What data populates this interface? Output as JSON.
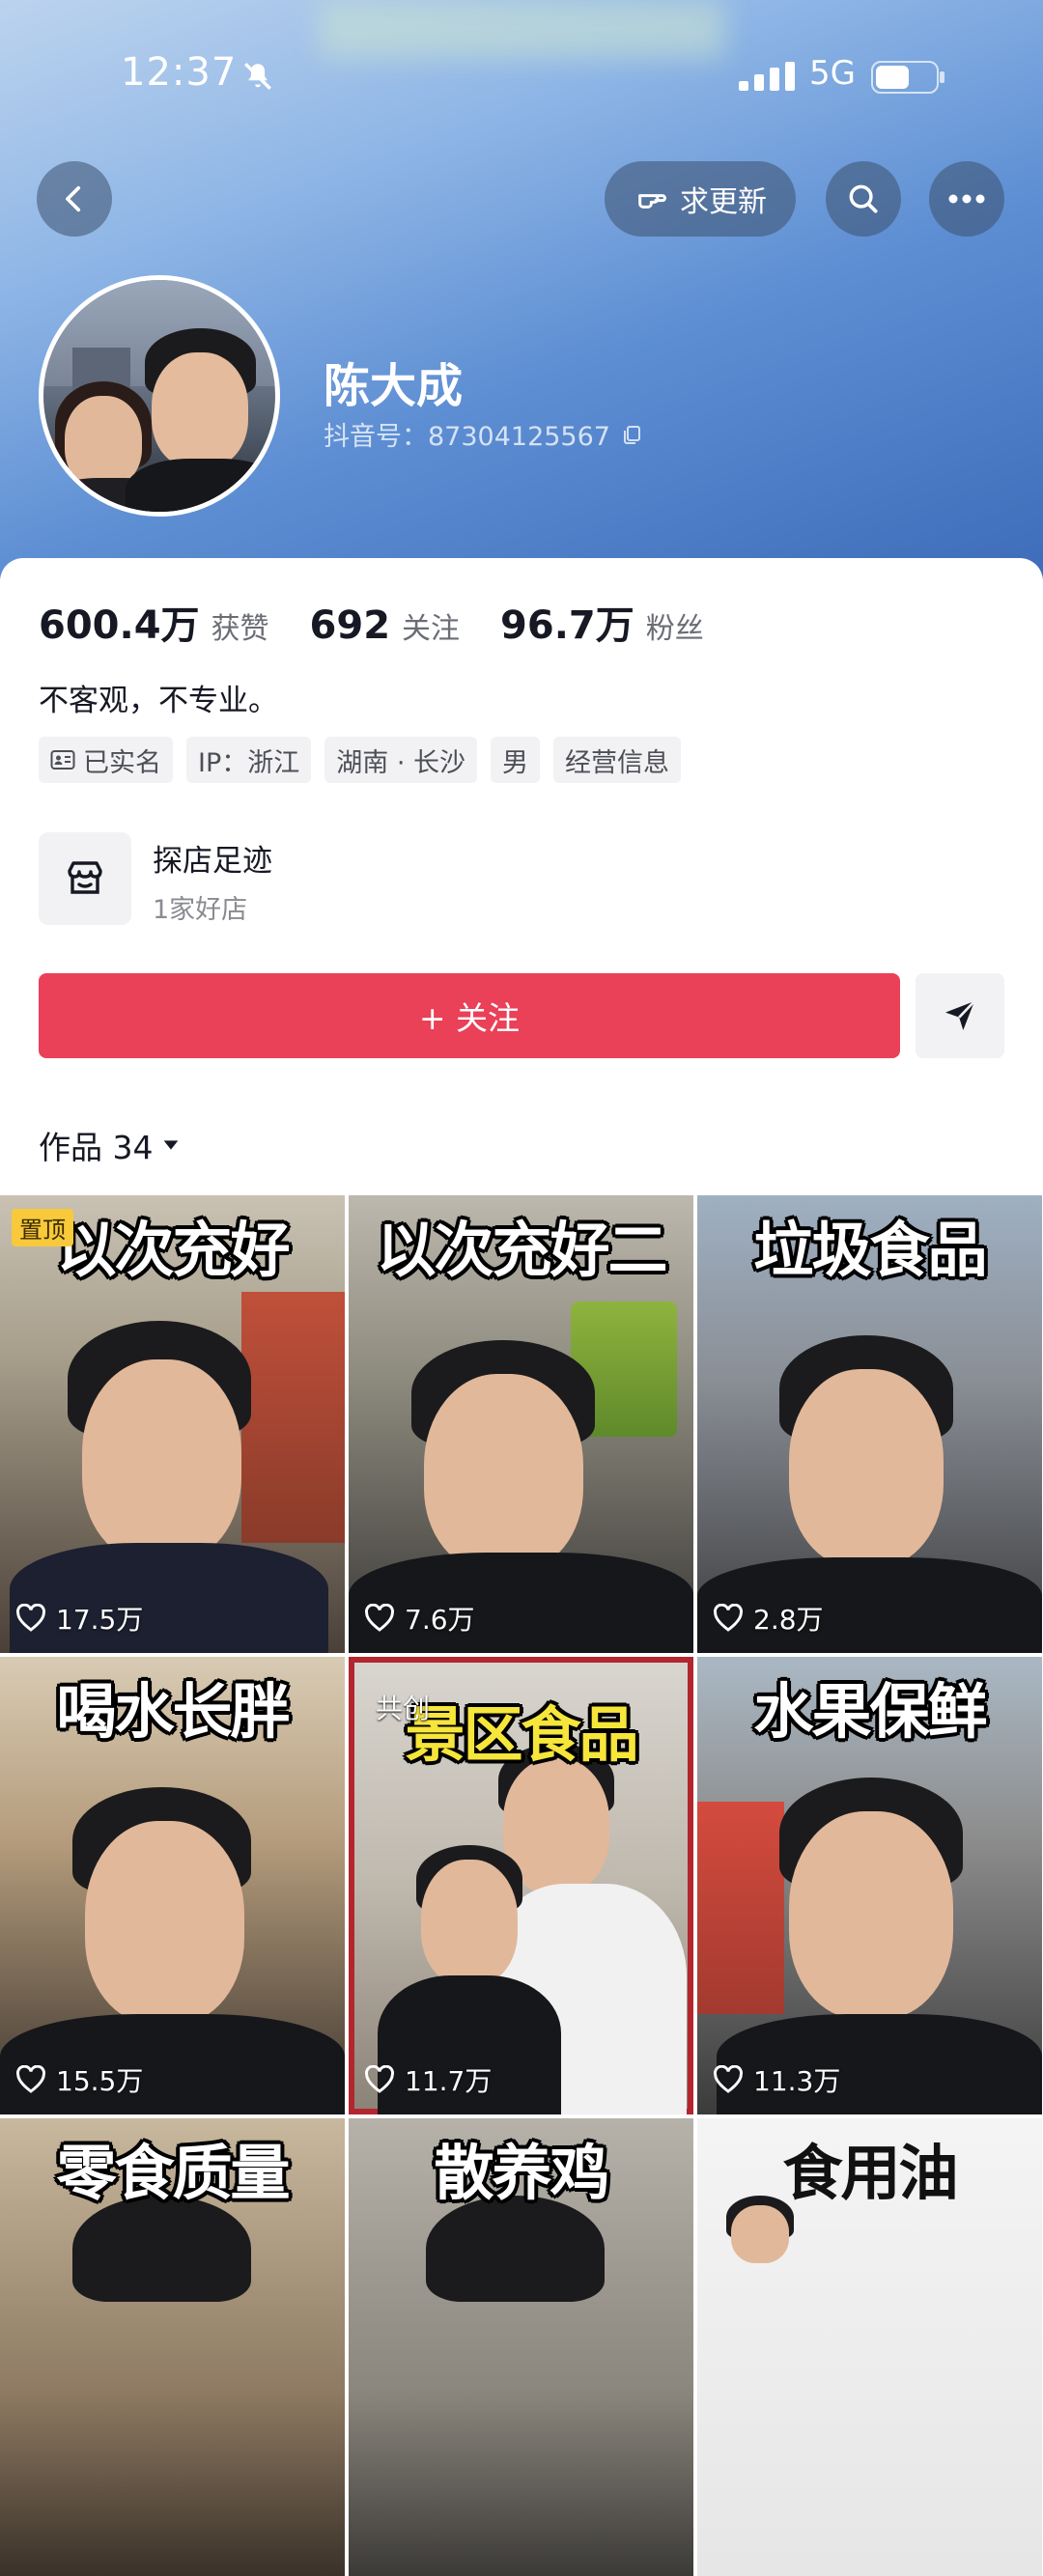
{
  "status_bar": {
    "time": "12:37",
    "network": "5G"
  },
  "top_bar": {
    "request_update_label": "求更新"
  },
  "profile": {
    "name": "陈大成",
    "douyin_id": "抖音号：87304125567"
  },
  "stats": [
    {
      "value": "600.4万",
      "label": "获赞"
    },
    {
      "value": "692",
      "label": "关注"
    },
    {
      "value": "96.7万",
      "label": "粉丝"
    }
  ],
  "bio": "不客观，不专业。",
  "tags": [
    "已实名",
    "IP：浙江",
    "湖南 · 长沙",
    "男",
    "经营信息"
  ],
  "shop": {
    "title": "探店足迹",
    "subtitle": "1家好店"
  },
  "follow_label": "+ 关注",
  "works_tab": {
    "label": "作品 34"
  },
  "videos": [
    {
      "title": "以次充好",
      "likes": "17.5万",
      "badge": "置顶",
      "title_color": "white"
    },
    {
      "title": "以次充好二",
      "likes": "7.6万",
      "badge": "",
      "title_color": "white"
    },
    {
      "title": "垃圾食品",
      "likes": "2.8万",
      "badge": "",
      "title_color": "white"
    },
    {
      "title": "喝水长胖",
      "likes": "15.5万",
      "badge": "",
      "title_color": "white"
    },
    {
      "title": "景区食品",
      "likes": "11.7万",
      "badge": "共创",
      "title_color": "yellow"
    },
    {
      "title": "水果保鲜",
      "likes": "11.3万",
      "badge": "",
      "title_color": "white"
    },
    {
      "title": "零食质量",
      "likes": "",
      "badge": "",
      "title_color": "white"
    },
    {
      "title": "散养鸡",
      "likes": "",
      "badge": "",
      "title_color": "white"
    },
    {
      "title": "食用油",
      "likes": "",
      "badge": "",
      "title_color": "white"
    }
  ],
  "colors": {
    "follow_button": "#ea4058",
    "pin_badge": "#f7c93b"
  }
}
